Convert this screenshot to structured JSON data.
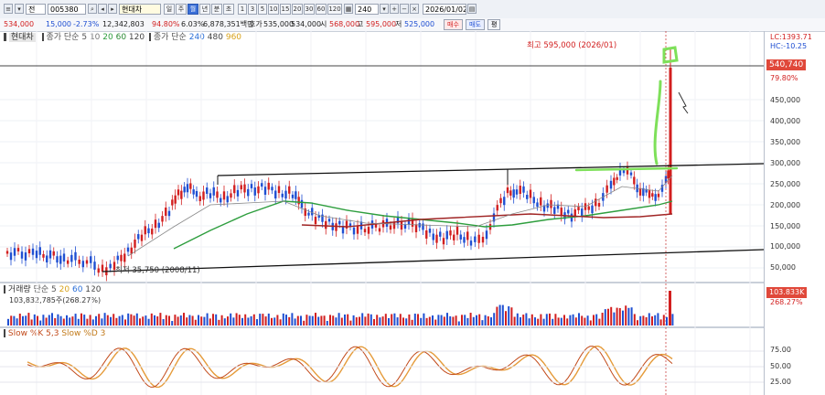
{
  "toolbar": {
    "window_label": "전",
    "code": "005380",
    "company": "현대차",
    "period_day": "일",
    "period_week": "주",
    "period_month": "월",
    "period_year": "년",
    "period_min": "분",
    "period_tick": "초",
    "tick_intervals": [
      "1",
      "3",
      "5",
      "10",
      "15",
      "20",
      "30",
      "60",
      "120"
    ],
    "count": "240",
    "date": "2026/01/02"
  },
  "quote": {
    "price": "534,000",
    "change": "15,000",
    "change_pct": "-2.73%",
    "volume": "12,342,803",
    "vol_ratio": "94.80%",
    "turnover_label": "6.03%",
    "amount": "6,878,351백만",
    "open_label": "호가",
    "open": "535,000",
    "prev_close": "534,000",
    "high_label": "시",
    "high": "568,000",
    "low_label": "고",
    "low_val": "595,000",
    "low_label2": "저",
    "close_low": "525,000",
    "buy": "매수",
    "sell": "매도",
    "flat": "평"
  },
  "price_panel": {
    "name": "현대차",
    "ma_label": "종가 단순",
    "ma_periods": [
      "5",
      "10",
      "20",
      "60",
      "120"
    ],
    "ma_label2": "종가 단순",
    "ma_periods2": [
      "240",
      "480",
      "960"
    ],
    "high_annotation": "최고 595,000 (2026/01)",
    "low_annotation": "최저 35,750 (2008/11)",
    "lc": "LC:1393.71",
    "hc": "HC:-10.25",
    "current_price": "540,740",
    "pct": "79.80%",
    "y_ticks": [
      "450,000",
      "400,000",
      "350,000",
      "300,000",
      "250,000",
      "200,000",
      "150,000",
      "100,000",
      "50,000"
    ]
  },
  "volume_panel": {
    "name": "거래량",
    "ma_label": "단순",
    "ma_periods": [
      "5",
      "20",
      "60",
      "120"
    ],
    "value": "103,832,785주(268.27%)",
    "current": "103.833K",
    "pct": "268.27%"
  },
  "stoch_panel": {
    "k_label": "Slow %K 5,3",
    "d_label": "Slow %D 3",
    "y_ticks": [
      "75.00",
      "50.00",
      "25.00"
    ]
  },
  "colors": {
    "up": "#d21f1f",
    "down": "#1f4fd2",
    "ma20": "#2e9e3e",
    "ma60": "#a02525",
    "highlight": "#7ee05a",
    "stoch_k": "#c24a1a",
    "stoch_d": "#e59b3a"
  }
}
